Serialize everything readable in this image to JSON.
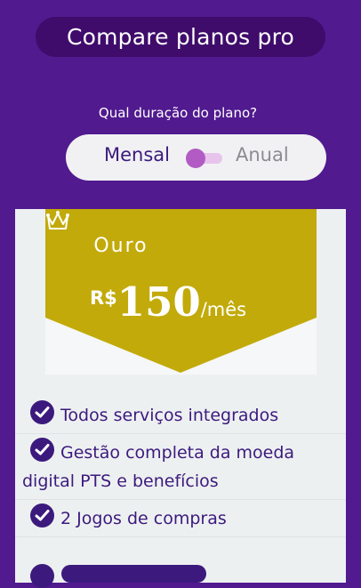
{
  "header": {
    "title": "Compare planos pro"
  },
  "billing": {
    "question": "Qual duração do plano?",
    "monthly_label": "Mensal",
    "annual_label": "Anual",
    "selected": "Mensal"
  },
  "plan": {
    "name": "Ouro",
    "currency": "R$",
    "amount": "150",
    "period": "/mês",
    "badge_icon": "crown-icon",
    "accent_color": "#c2aa0a"
  },
  "features": [
    {
      "label": "Todos serviços integrados",
      "icon": "check-circle-icon"
    },
    {
      "label": "Gestão completa da moeda digital PTS e benefícios",
      "icon": "check-circle-icon"
    },
    {
      "label": "2 Jogos de compras",
      "icon": "check-circle-icon"
    }
  ],
  "colors": {
    "background": "#511a8f",
    "primary_text": "#3c1a7d",
    "toggle_knob": "#b25bc4"
  }
}
